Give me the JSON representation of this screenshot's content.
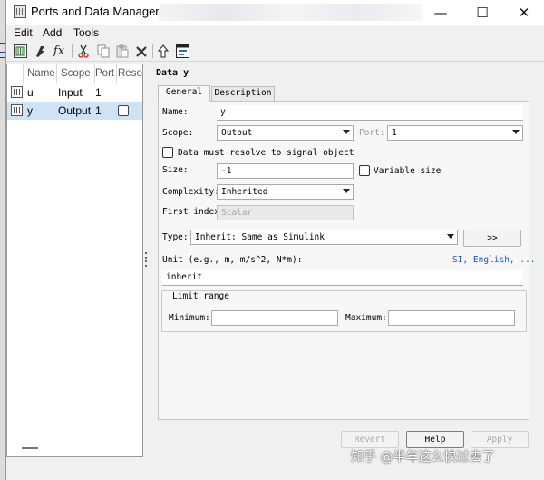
{
  "window": {
    "title": "Ports and Data Manager (",
    "minimize_glyph": "—",
    "maximize_glyph": "☐",
    "close_glyph": "✕"
  },
  "menu": [
    "Edit",
    "Add",
    "Tools"
  ],
  "toolbar": {
    "icons": [
      "port-table-icon",
      "add-data-icon",
      "add-function-icon",
      "cut-icon",
      "copy-icon",
      "paste-icon",
      "delete-icon",
      "go-to-parent-icon",
      "model-explorer-icon"
    ],
    "fx_label": "fx"
  },
  "list": {
    "columns": [
      "Name",
      "Scope",
      "Port",
      "Resolve"
    ],
    "rows": [
      {
        "name": "u",
        "scope": "Input",
        "port": "1",
        "resolve_checkbox": false,
        "selected": false
      },
      {
        "name": "y",
        "scope": "Output",
        "port": "1",
        "resolve_checkbox": true,
        "selected": true
      }
    ]
  },
  "detail": {
    "heading": "Data y",
    "tabs": [
      "General",
      "Description"
    ],
    "active_tab": "General",
    "name_label": "Name:",
    "name_value": "y",
    "scope_label": "Scope:",
    "scope_value": "Output",
    "port_label": "Port:",
    "port_value": "1",
    "resolve_label": "Data must resolve to signal object",
    "size_label": "Size:",
    "size_value": "-1",
    "variable_size_label": "Variable size",
    "complexity_label": "Complexity:",
    "complexity_value": "Inherited",
    "first_index_label": "First index",
    "first_index_placeholder": "Scalar",
    "type_label": "Type:",
    "type_value": "Inherit: Same as Simulink",
    "type_assistant_button": ">>",
    "unit_label": "Unit (e.g., m, m/s^2, N*m):",
    "unit_link": "SI, English, ...",
    "unit_value": "inherit",
    "limit_range_label": "Limit range",
    "minimum_label": "Minimum:",
    "maximum_label": "Maximum:",
    "minimum_value": "",
    "maximum_value": ""
  },
  "footer": {
    "revert": "Revert",
    "help": "Help",
    "apply": "Apply"
  },
  "watermark": "知乎 @半年这么快过去了",
  "colors": {
    "selection": "#cfe3f7",
    "link": "#1f55c7",
    "disabled_text": "#a8a8a8"
  }
}
